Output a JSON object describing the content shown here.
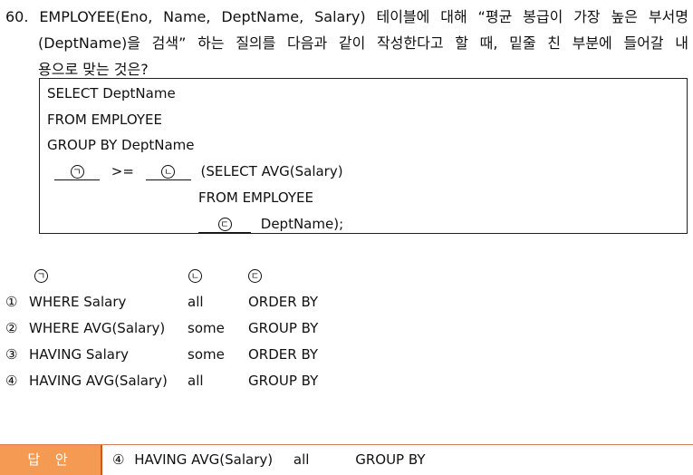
{
  "question": {
    "line1": "60. EMPLOYEE(Eno, Name, DeptName, Salary) 테이블에 대해 “평균 봉급이 가장 높은 부서명",
    "line2": "(DeptName)을 검색” 하는 질의를 다음과 같이 작성한다고 할 때, 밑줄 친 부분에 들어갈 내",
    "line3": "용으로 맞는 것은?"
  },
  "code": {
    "line1": "SELECT DeptName",
    "line2": "FROM EMPLOYEE",
    "line3": "GROUP BY DeptName",
    "blank1_mark": "ㄱ",
    "operator": ">=",
    "blank2_mark": "ㄴ",
    "subquery_start": "(SELECT AVG(Salary)",
    "subquery_from": "FROM EMPLOYEE",
    "blank3_mark": "ㄷ",
    "subquery_end": "DeptName);"
  },
  "options": {
    "header": {
      "a": "ㄱ",
      "b": "ㄴ",
      "c": "ㄷ"
    },
    "rows": [
      {
        "num": "①",
        "a": "WHERE Salary",
        "b": "all",
        "c": "ORDER BY"
      },
      {
        "num": "②",
        "a": "WHERE AVG(Salary)",
        "b": "some",
        "c": "GROUP BY"
      },
      {
        "num": "③",
        "a": "HAVING Salary",
        "b": "some",
        "c": "ORDER BY"
      },
      {
        "num": "④",
        "a": "HAVING AVG(Salary)",
        "b": "all",
        "c": "GROUP BY"
      }
    ]
  },
  "answer": {
    "label": "답 안",
    "num": "④",
    "a": "HAVING AVG(Salary)",
    "b": "all",
    "c": "GROUP BY"
  },
  "colors": {
    "answer_label_bg": "#f59a52",
    "answer_label_text": "#ffffff"
  }
}
